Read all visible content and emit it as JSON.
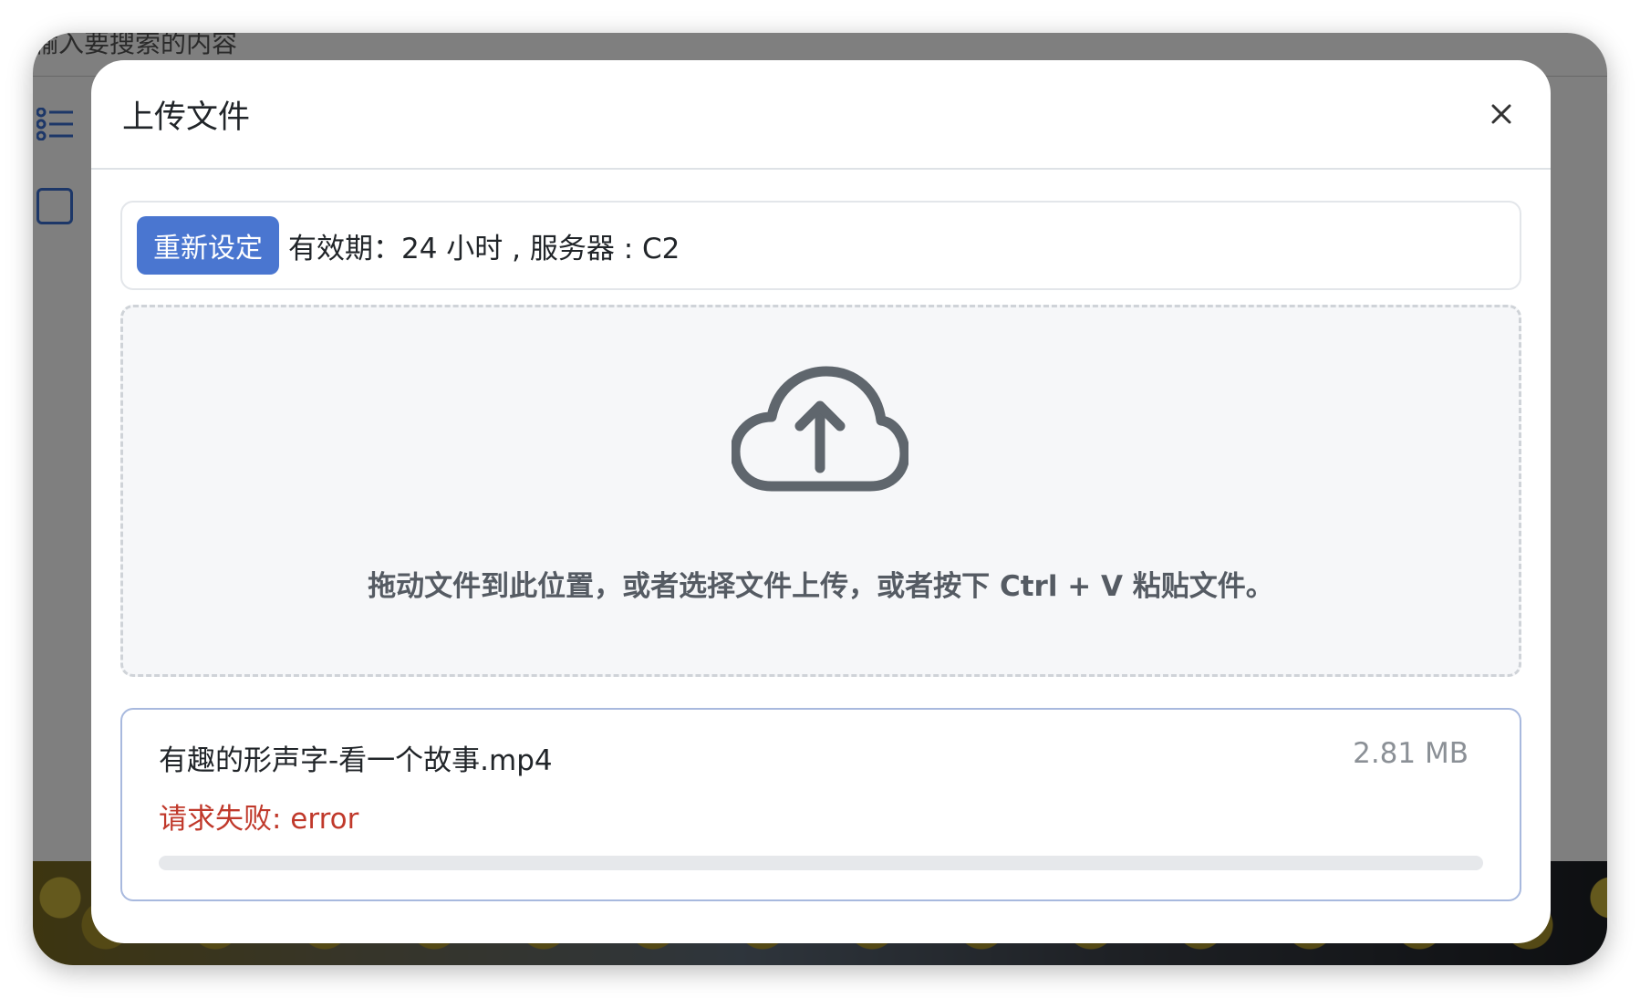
{
  "background": {
    "search_placeholder": "输入要搜索的内容"
  },
  "modal": {
    "title": "上传文件",
    "close_icon": "close-icon"
  },
  "settings": {
    "reset_label": "重新设定",
    "info_text": "有效期：24 小时 , 服务器 : C2"
  },
  "dropzone": {
    "icon": "cloud-upload-icon",
    "hint": "拖动文件到此位置，或者选择文件上传，或者按下 Ctrl + V 粘贴文件。"
  },
  "upload_item": {
    "file_name": "有趣的形声字-看一个故事.mp4",
    "file_size": "2.81 MB",
    "status": "请求失败: error",
    "progress_percent": 0
  },
  "colors": {
    "accent": "#4a76d0",
    "error": "#c0392b",
    "overlay": "rgba(0,0,0,0.5)"
  }
}
